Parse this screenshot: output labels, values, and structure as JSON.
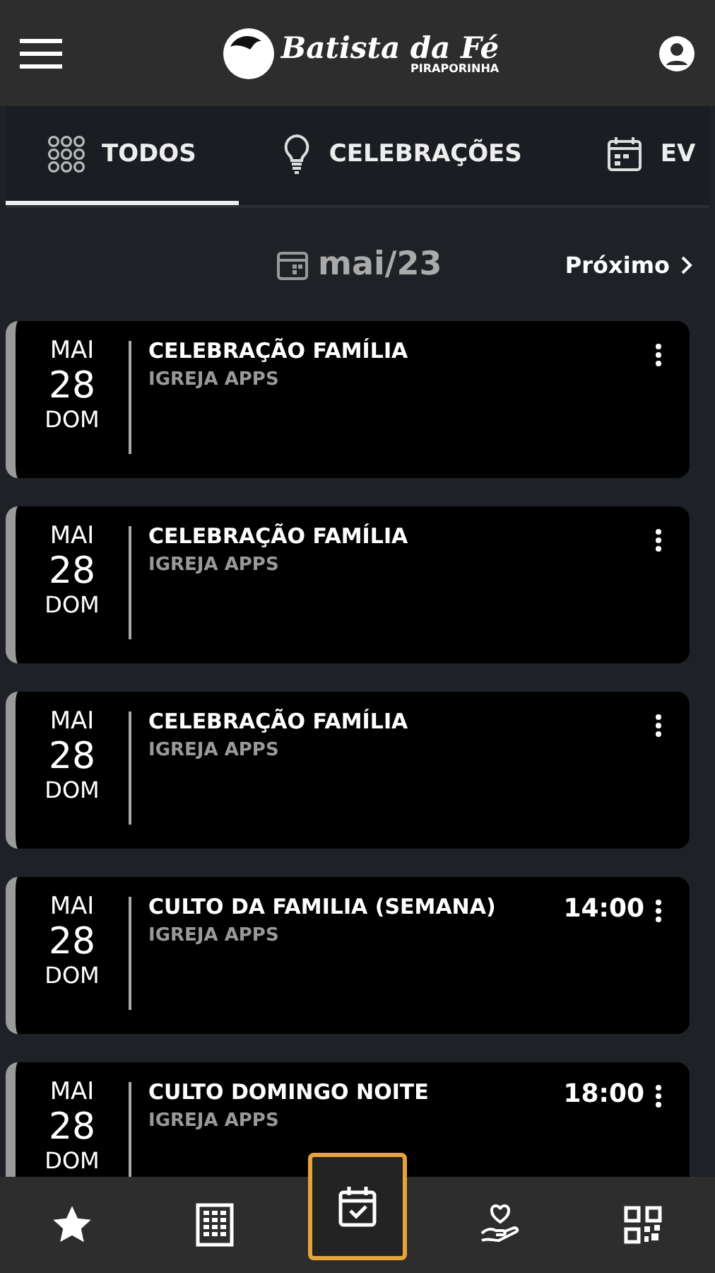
{
  "header": {
    "logo_title": "Batista da Fé",
    "logo_subtitle": "PIRAPORINHA"
  },
  "tabs": [
    {
      "label": "TODOS",
      "selected": true
    },
    {
      "label": "CELEBRAÇÕES",
      "selected": false
    },
    {
      "label": "EV",
      "selected": false
    }
  ],
  "month": {
    "label": "mai/23",
    "next": "Próximo"
  },
  "events": [
    {
      "month": "MAI",
      "day": "28",
      "weekday": "DOM",
      "title": "CELEBRAÇÃO FAMÍLIA",
      "subtitle": "IGREJA APPS"
    },
    {
      "month": "MAI",
      "day": "28",
      "weekday": "DOM",
      "title": "CELEBRAÇÃO FAMÍLIA",
      "subtitle": "IGREJA APPS"
    },
    {
      "month": "MAI",
      "day": "28",
      "weekday": "DOM",
      "title": "CELEBRAÇÃO FAMÍLIA",
      "subtitle": "IGREJA APPS"
    },
    {
      "month": "MAI",
      "day": "28",
      "weekday": "DOM",
      "title": "CULTO DA FAMILIA (SEMANA)",
      "subtitle": "IGREJA APPS",
      "time": "14:00"
    },
    {
      "month": "MAI",
      "day": "28",
      "weekday": "DOM",
      "title": "CULTO DOMINGO NOITE",
      "subtitle": "IGREJA APPS",
      "time": "18:00"
    }
  ],
  "nav": [
    {
      "selected": false
    },
    {
      "selected": false
    },
    {
      "selected": true
    },
    {
      "selected": false
    },
    {
      "selected": false
    }
  ]
}
